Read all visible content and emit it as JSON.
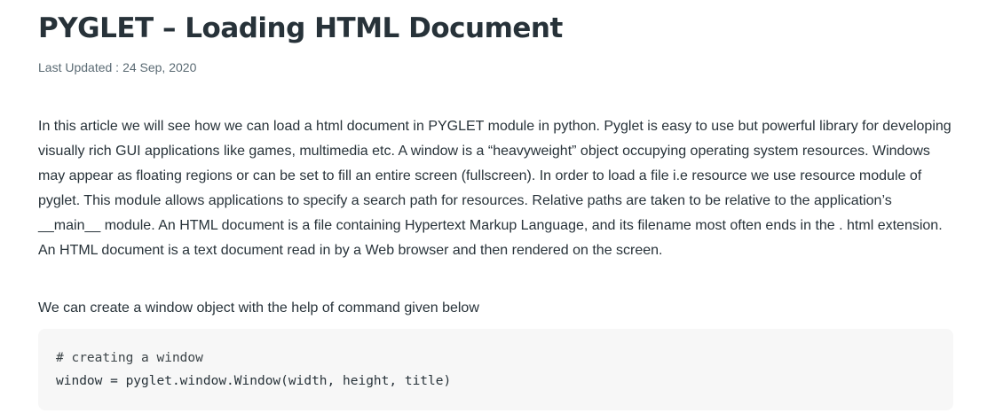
{
  "article": {
    "title": "PYGLET – Loading HTML Document",
    "last_updated_label": "Last Updated :",
    "last_updated_date": "24 Sep, 2020",
    "paragraphs": [
      "In this article we will see how we can load a html document in PYGLET module in python. Pyglet is easy to use but powerful library for developing visually rich GUI applications like games, multimedia etc. A window is a “heavyweight” object occupying operating system resources. Windows may appear as floating regions or can be set to fill an entire screen (fullscreen). In order to load a file i.e resource we use resource module of pyglet. This module allows applications to specify a search path for resources. Relative paths are taken to be relative to the application’s __main__ module. An HTML document is a file containing Hypertext Markup Language, and its filename most often ends in the . html extension. An HTML document is a text document read in by a Web browser and then rendered on the screen.",
      "We can create a window object with the help of command given below"
    ],
    "code": {
      "lines": [
        "# creating a window",
        "window = pyglet.window.Window(width, height, title)"
      ]
    }
  }
}
